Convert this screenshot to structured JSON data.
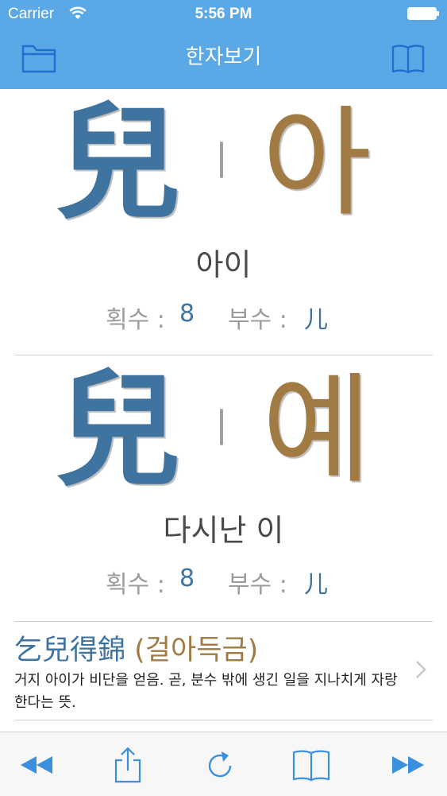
{
  "status_bar": {
    "carrier": "Carrier",
    "time": "5:56 PM"
  },
  "nav": {
    "title": "한자보기"
  },
  "entries": [
    {
      "hanja": "兒",
      "reading": "아",
      "meaning": "아이",
      "strokes_label": "획수 :",
      "strokes": "8",
      "radical_label": "부수 :",
      "radical": "儿"
    },
    {
      "hanja": "兒",
      "reading": "예",
      "meaning": "다시난 이",
      "strokes_label": "획수 :",
      "strokes": "8",
      "radical_label": "부수 :",
      "radical": "儿"
    }
  ],
  "idioms": [
    {
      "hanja": "乞兒得錦",
      "reading": "(걸아득금)",
      "description": "거지 아이가 비단을 얻음. 곧, 분수 밖에 생긴 일을 지나치게 자랑한다는 뜻."
    }
  ],
  "colors": {
    "nav_bar": "#5aa9e6",
    "hanja": "#3f73a0",
    "reading": "#a27a43",
    "toolbar_icon": "#3a8fde"
  },
  "icons": {
    "nav_left": "folder-icon",
    "nav_right": "book-icon",
    "toolbar": [
      "rewind-icon",
      "share-icon",
      "reload-icon",
      "book-icon",
      "fast-forward-icon"
    ]
  }
}
